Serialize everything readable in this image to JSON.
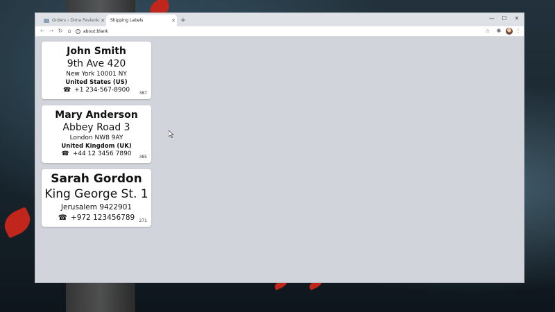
{
  "browser": {
    "tabs": [
      {
        "title": "Orders ‹ Dima Pavlenko — Word",
        "active": false
      },
      {
        "title": "Shipping Labels",
        "active": true
      }
    ],
    "address": "about:blank",
    "new_tab_symbol": "+",
    "close_symbol": "✕",
    "window_controls": {
      "minimize": "—",
      "maximize": "☐",
      "close": "✕"
    },
    "nav": {
      "back": "←",
      "forward": "→",
      "reload": "↻",
      "home": "⌂"
    },
    "toolbar_icons": {
      "bookmark": "☆",
      "extensions": "✱",
      "menu": "⋮"
    }
  },
  "labels": [
    {
      "name": "John Smith",
      "street": "9th Ave 420",
      "city": "New York 10001 NY",
      "country": "United States (US)",
      "phone_icon": "☎",
      "phone": "+1 234-567-8900",
      "id": "387"
    },
    {
      "name": "Mary Anderson",
      "street": "Abbey Road 3",
      "city": "London NW8 9AY",
      "country": "United Kingdom (UK)",
      "phone_icon": "☎",
      "phone": "+44 12 3456 7890",
      "id": "385"
    },
    {
      "name": "Sarah Gordon",
      "street": "King George St. 1",
      "city": "Jerusalem 9422901",
      "phone_icon": "☎",
      "phone": "+972 123456789",
      "id": "271"
    }
  ],
  "colors": {
    "page_background": "#d2d4dc",
    "card_background": "#ffffff",
    "chrome_frame": "#dee1e6"
  }
}
